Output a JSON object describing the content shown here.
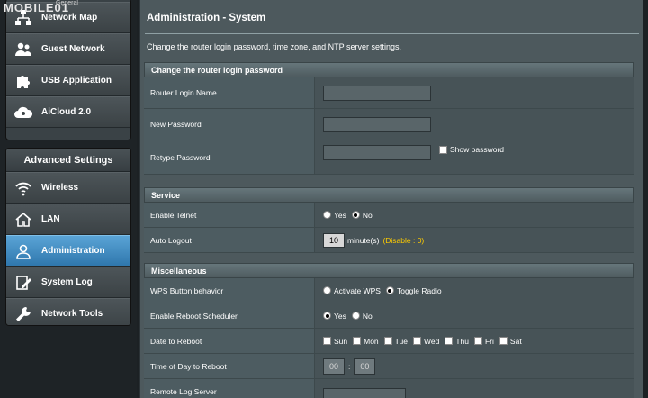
{
  "watermark": {
    "brand": "MOBILE01",
    "overlay": "General"
  },
  "sidebar": {
    "general_items": [
      {
        "label": "Network Map",
        "icon": "network-map-icon"
      },
      {
        "label": "Guest Network",
        "icon": "guest-network-icon"
      },
      {
        "label": "USB Application",
        "icon": "usb-puzzle-icon"
      },
      {
        "label": "AiCloud 2.0",
        "icon": "cloud-icon"
      }
    ],
    "advanced_title": "Advanced Settings",
    "advanced_items": [
      {
        "label": "Wireless",
        "icon": "wifi-icon"
      },
      {
        "label": "LAN",
        "icon": "house-icon"
      },
      {
        "label": "Administration",
        "icon": "user-icon",
        "active": true
      },
      {
        "label": "System Log",
        "icon": "log-edit-icon"
      },
      {
        "label": "Network Tools",
        "icon": "wrench-icon"
      }
    ]
  },
  "page": {
    "title": "Administration - System",
    "description": "Change the router login password, time zone, and NTP server settings."
  },
  "login": {
    "header": "Change the router login password",
    "login_name_label": "Router Login Name",
    "login_name_value": "",
    "new_password_label": "New Password",
    "new_password_value": "",
    "retype_label": "Retype Password",
    "retype_value": "",
    "show_password_label": "Show password"
  },
  "service": {
    "header": "Service",
    "telnet_label": "Enable Telnet",
    "yes": "Yes",
    "no": "No",
    "auto_logout_label": "Auto Logout",
    "auto_logout_value": "10",
    "auto_logout_unit": "minute(s)",
    "auto_logout_hint": "(Disable : 0)"
  },
  "misc": {
    "header": "Miscellaneous",
    "wps_label": "WPS Button behavior",
    "wps_opt1": "Activate WPS",
    "wps_opt2": "Toggle Radio",
    "reboot_label": "Enable Reboot Scheduler",
    "yes": "Yes",
    "no": "No",
    "date_label": "Date to Reboot",
    "days": [
      "Sun",
      "Mon",
      "Tue",
      "Wed",
      "Thu",
      "Fri",
      "Sat"
    ],
    "time_label": "Time of Day to Reboot",
    "hour": "00",
    "minute": "00",
    "separator": ":",
    "log_server_label": "Remote Log Server"
  },
  "colors": {
    "accent": "#3a8cc6",
    "hint": "#ffcc00",
    "panel": "#4d595d"
  }
}
